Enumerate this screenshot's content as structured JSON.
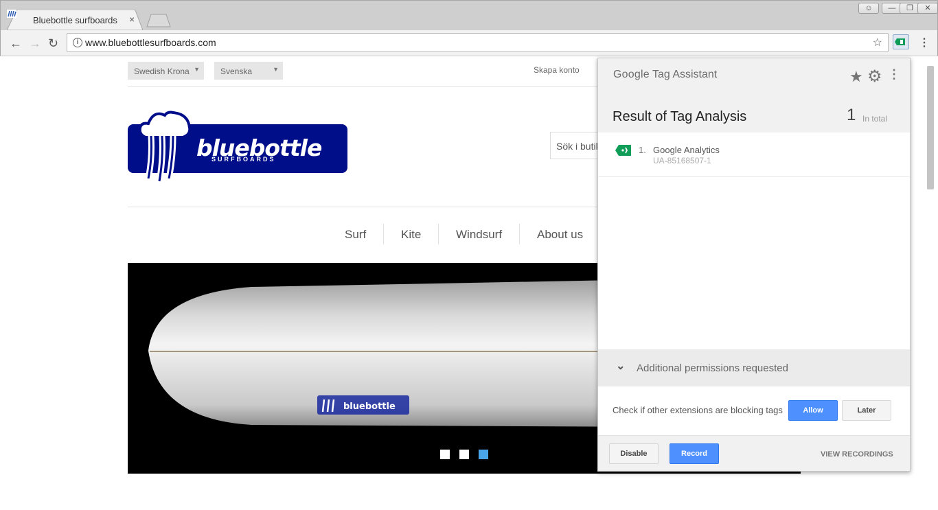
{
  "browser": {
    "tab_title": "Bluebottle surfboards",
    "tab_close": "×",
    "url": "www.bluebottlesurfboards.com",
    "menu_glyph": "⋮",
    "window_buttons": {
      "profile": "☺",
      "minimize": "—",
      "maximize": "❐",
      "close": "✕"
    }
  },
  "site": {
    "currency": "Swedish Krona",
    "language": "Svenska",
    "create_account": "Skapa konto",
    "logo_word": "bluebottle",
    "logo_sub": "SURFBOARDS",
    "search_placeholder": "Sök i butik",
    "nav": [
      "Surf",
      "Kite",
      "Windsurf",
      "About us"
    ],
    "hero_logo_word": "bluebottle",
    "slider_dots": 3,
    "active_dot": 3,
    "brand_color": "#000e8a"
  },
  "tag_assistant": {
    "brand_google": "Google",
    "brand_product": " Tag Assistant",
    "title": "Result of Tag Analysis",
    "count": "1",
    "count_label": "In total",
    "tags": [
      {
        "num": "1.",
        "name": "Google Analytics",
        "id": "UA-85168507-1",
        "color": "#0f9d58"
      }
    ],
    "permissions_label": "Additional permissions requested",
    "check_text": "Check if other extensions are blocking tags",
    "allow_button": "Allow",
    "later_button": "Later",
    "disable_button": "Disable",
    "record_button": "Record",
    "view_recordings": "VIEW RECORDINGS",
    "accent_color": "#4d90fe"
  }
}
